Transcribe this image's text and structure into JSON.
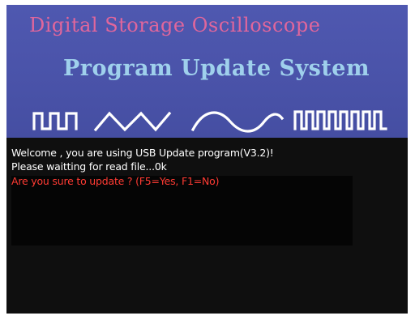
{
  "banner": {
    "title": "Digital Storage Oscilloscope",
    "subtitle": "Program Update System",
    "waveform_icons": [
      "square-wave-icon",
      "triangle-wave-icon",
      "sine-wave-icon",
      "pulse-train-icon"
    ],
    "colors": {
      "background": "#4a53a9",
      "title": "#e0669c",
      "subtitle": "#9fd0ec",
      "waves": "#ffffff"
    }
  },
  "terminal": {
    "lines": [
      "Welcome , you are using USB Update program(V3.2)!",
      "Please waitting for read file...0k",
      "Are you sure to update ? (F5=Yes, F1=No)"
    ],
    "colors": {
      "background": "#0f0f0f",
      "text": "#ffffff",
      "prompt": "#ff3b33"
    }
  }
}
